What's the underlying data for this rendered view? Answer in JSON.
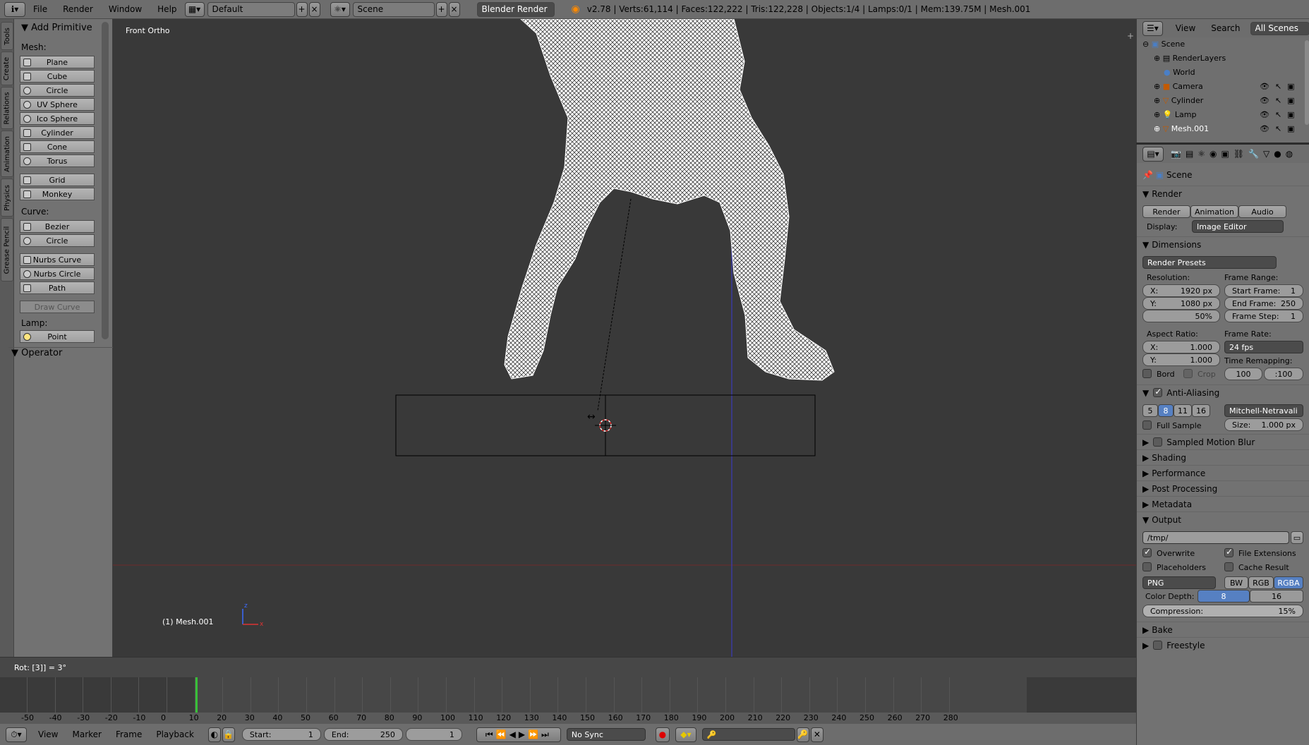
{
  "topbar": {
    "menus": [
      "File",
      "Render",
      "Window",
      "Help"
    ],
    "layout": "Default",
    "scene": "Scene",
    "engine": "Blender Render",
    "stats": "v2.78 | Verts:61,114 | Faces:122,222 | Tris:122,228 | Objects:1/4 | Lamps:0/1 | Mem:139.75M | Mesh.001"
  },
  "tabs": [
    "Tools",
    "Create",
    "Relations",
    "Animation",
    "Physics",
    "Grease Pencil"
  ],
  "tools": {
    "header": "Add Primitive",
    "mesh_label": "Mesh:",
    "mesh": [
      "Plane",
      "Cube",
      "Circle",
      "UV Sphere",
      "Ico Sphere",
      "Cylinder",
      "Cone",
      "Torus"
    ],
    "mesh2": [
      "Grid",
      "Monkey"
    ],
    "curve_label": "Curve:",
    "curve": [
      "Bezier",
      "Circle"
    ],
    "curve2": [
      "Nurbs Curve",
      "Nurbs Circle",
      "Path"
    ],
    "draw_curve": "Draw Curve",
    "lamp_label": "Lamp:",
    "lamp": [
      "Point"
    ],
    "operator": "Operator"
  },
  "viewport": {
    "view_label": "Front Ortho",
    "object_label": "(1) Mesh.001",
    "status": "Rot: [3]] = 3°"
  },
  "outliner": {
    "menus": [
      "View",
      "Search"
    ],
    "filter": "All Scenes",
    "items": [
      "Scene",
      "RenderLayers",
      "World",
      "Camera",
      "Cylinder",
      "Lamp",
      "Mesh.001"
    ]
  },
  "properties": {
    "context": "Scene",
    "render": {
      "title": "Render",
      "buttons": [
        "Render",
        "Animation",
        "Audio"
      ],
      "display_label": "Display:",
      "display_value": "Image Editor"
    },
    "dimensions": {
      "title": "Dimensions",
      "presets": "Render Presets",
      "resolution_label": "Resolution:",
      "res_x": "X:",
      "res_x_val": "1920 px",
      "res_y": "Y:",
      "res_y_val": "1080 px",
      "res_pct": "50%",
      "frame_range_label": "Frame Range:",
      "start": "Start Frame:",
      "start_val": "1",
      "end": "End Frame:",
      "end_val": "250",
      "step": "Frame Step:",
      "step_val": "1",
      "aspect_label": "Aspect Ratio:",
      "asp_x": "X:",
      "asp_x_val": "1.000",
      "asp_y": "Y:",
      "asp_y_val": "1.000",
      "frame_rate_label": "Frame Rate:",
      "fps": "24 fps",
      "time_remap_label": "Time Remapping:",
      "remap_old": "100",
      "remap_new": ":100",
      "bord": "Bord",
      "crop": "Crop"
    },
    "aa": {
      "title": "Anti-Aliasing",
      "samples": [
        "5",
        "8",
        "11",
        "16"
      ],
      "filter": "Mitchell-Netravali",
      "full_sample": "Full Sample",
      "size_label": "Size:",
      "size_val": "1.000 px"
    },
    "collapsed": [
      "Sampled Motion Blur",
      "Shading",
      "Performance",
      "Post Processing",
      "Metadata"
    ],
    "output": {
      "title": "Output",
      "path": "/tmp/",
      "overwrite": "Overwrite",
      "file_ext": "File Extensions",
      "placeholders": "Placeholders",
      "cache": "Cache Result",
      "format": "PNG",
      "modes": [
        "BW",
        "RGB",
        "RGBA"
      ],
      "depth_label": "Color Depth:",
      "depths": [
        "8",
        "16"
      ],
      "compression_label": "Compression:",
      "compression_val": "15%"
    },
    "bottom": [
      "Bake",
      "Freestyle"
    ]
  },
  "timeline": {
    "ruler": [
      "-50",
      "-40",
      "-30",
      "-20",
      "-10",
      "0",
      "10",
      "20",
      "30",
      "40",
      "50",
      "60",
      "70",
      "80",
      "90",
      "100",
      "110",
      "120",
      "130",
      "140",
      "150",
      "160",
      "170",
      "180",
      "190",
      "200",
      "210",
      "220",
      "230",
      "240",
      "250",
      "260",
      "270",
      "280"
    ],
    "menus": [
      "View",
      "Marker",
      "Frame",
      "Playback"
    ],
    "start_label": "Start:",
    "start_val": "1",
    "end_label": "End:",
    "end_val": "250",
    "current": "1",
    "sync": "No Sync"
  }
}
